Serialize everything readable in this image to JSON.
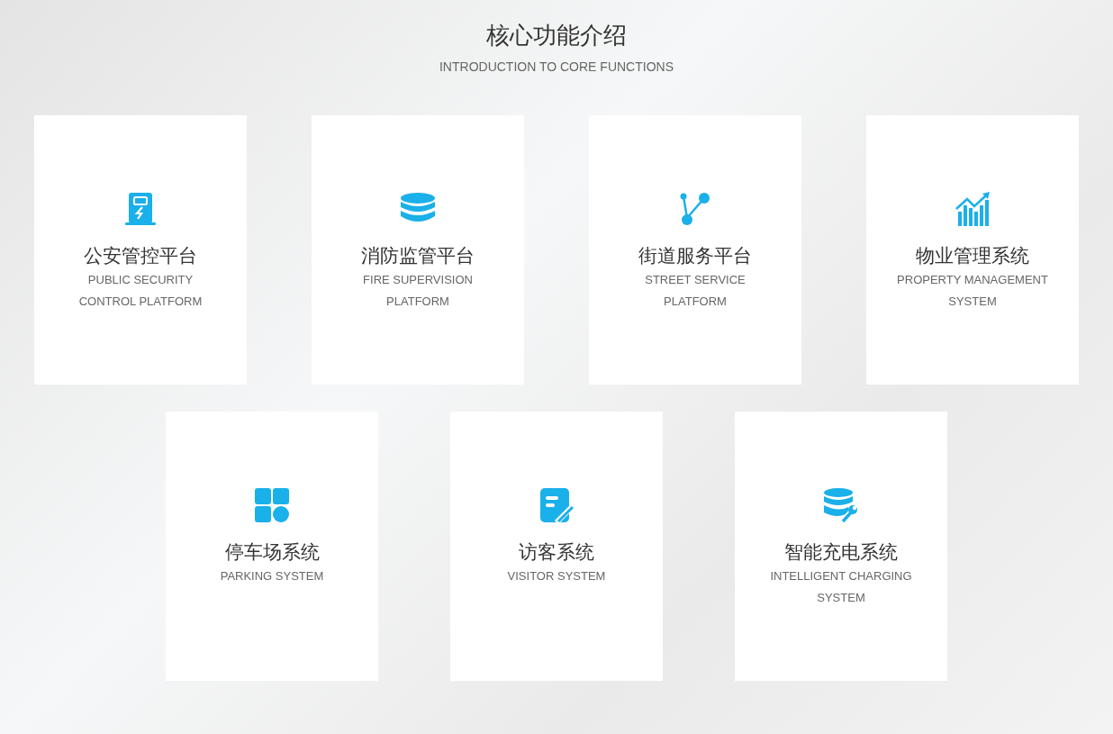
{
  "heading": {
    "title": "核心功能介绍",
    "subtitle": "INTRODUCTION TO CORE FUNCTIONS"
  },
  "rows": [
    {
      "cards": [
        {
          "kind": "charger",
          "title": "公安管控平台",
          "subtitle": "PUBLIC SECURITY CONTROL PLATFORM"
        },
        {
          "kind": "database",
          "title": "消防监管平台",
          "subtitle": "FIRE SUPERVISION PLATFORM"
        },
        {
          "kind": "nodes",
          "title": "街道服务平台",
          "subtitle": "STREET SERVICE PLATFORM"
        },
        {
          "kind": "chart",
          "title": "物业管理系统",
          "subtitle": "PROPERTY MANAGEMENT SYSTEM"
        }
      ]
    },
    {
      "cards": [
        {
          "kind": "grid",
          "title": "停车场系统",
          "subtitle": "PARKING SYSTEM"
        },
        {
          "kind": "note",
          "title": "访客系统",
          "subtitle": "VISITOR SYSTEM"
        },
        {
          "kind": "dbtool",
          "title": "智能充电系统",
          "subtitle": "INTELLIGENT CHARGING SYSTEM"
        }
      ]
    }
  ]
}
